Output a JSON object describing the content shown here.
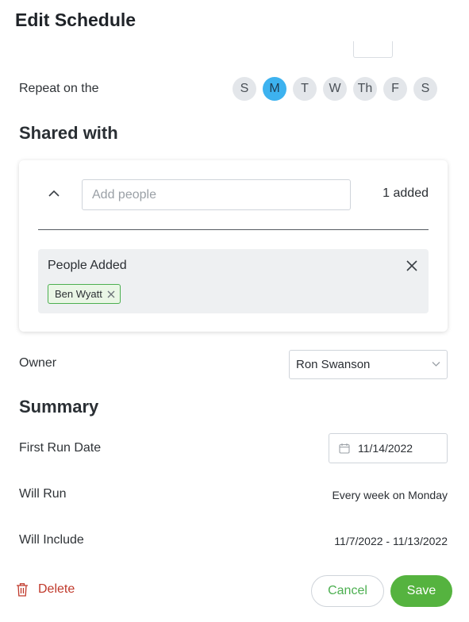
{
  "dialog": {
    "title": "Edit Schedule"
  },
  "repeat": {
    "label": "Repeat on the",
    "days": [
      {
        "label": "S",
        "selected": false
      },
      {
        "label": "M",
        "selected": true
      },
      {
        "label": "T",
        "selected": false
      },
      {
        "label": "W",
        "selected": false
      },
      {
        "label": "Th",
        "selected": false
      },
      {
        "label": "F",
        "selected": false
      },
      {
        "label": "S",
        "selected": false
      }
    ]
  },
  "shared": {
    "title": "Shared with",
    "input_placeholder": "Add people",
    "added_count": "1 added",
    "people_title": "People Added",
    "people": [
      "Ben Wyatt"
    ]
  },
  "owner": {
    "label": "Owner",
    "value": "Ron Swanson"
  },
  "summary": {
    "title": "Summary",
    "first_run_label": "First Run Date",
    "first_run_value": "11/14/2022",
    "will_run_label": "Will Run",
    "will_run_value": "Every week on Monday",
    "will_include_label": "Will Include",
    "will_include_value": "11/7/2022 - 11/13/2022"
  },
  "actions": {
    "delete": "Delete",
    "cancel": "Cancel",
    "save": "Save"
  },
  "colors": {
    "accent": "#3db2ef",
    "primary": "#55b33f",
    "danger": "#c0392b"
  }
}
